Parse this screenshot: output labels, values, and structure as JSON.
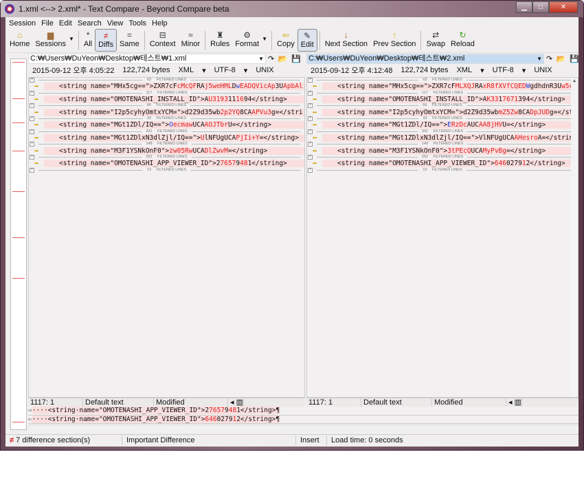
{
  "window": {
    "title": "1.xml <--> 2.xml* - Text Compare - Beyond Compare beta"
  },
  "menu": [
    "Session",
    "File",
    "Edit",
    "Search",
    "View",
    "Tools",
    "Help"
  ],
  "toolbar": [
    {
      "label": "Home",
      "icon": "home-icon",
      "glyph": "⌂"
    },
    {
      "label": "Sessions",
      "icon": "briefcase-icon",
      "glyph": "▆",
      "dropdown": true
    },
    {
      "sep": true
    },
    {
      "label": "All",
      "icon": "asterisk-icon",
      "glyph": "*"
    },
    {
      "label": "Diffs",
      "icon": "not-equal-icon",
      "glyph": "≠",
      "active": true
    },
    {
      "label": "Same",
      "icon": "equal-icon",
      "glyph": "="
    },
    {
      "sep": true
    },
    {
      "label": "Context",
      "icon": "context-icon",
      "glyph": "⊟"
    },
    {
      "label": "Minor",
      "icon": "approx-icon",
      "glyph": "≈"
    },
    {
      "sep": true
    },
    {
      "label": "Rules",
      "icon": "rules-icon",
      "glyph": "♜"
    },
    {
      "label": "Format",
      "icon": "format-icon",
      "glyph": "⚙",
      "dropdown": true
    },
    {
      "sep": true
    },
    {
      "label": "Copy",
      "icon": "copy-left-arrow-icon",
      "glyph": "⇦"
    },
    {
      "label": "Edit",
      "icon": "edit-icon",
      "glyph": "✎",
      "active": true
    },
    {
      "sep": true
    },
    {
      "label": "Next Section",
      "icon": "down-arrow-icon",
      "glyph": "↓"
    },
    {
      "label": "Prev Section",
      "icon": "up-arrow-icon",
      "glyph": "↑"
    },
    {
      "sep": true
    },
    {
      "label": "Swap",
      "icon": "swap-icon",
      "glyph": "⇄"
    },
    {
      "label": "Reload",
      "icon": "reload-icon",
      "glyph": "↻"
    }
  ],
  "colors": {
    "diff_bg": "#fadede",
    "diff_text": "#e02020",
    "minor_text": "#2040e0",
    "selected_path": "#c6dcf2"
  },
  "filtered_label": "FILTERED LINES",
  "filtered_counts": [
    "63",
    "117",
    "66",
    "33",
    "331",
    "148",
    "292",
    "13"
  ],
  "left": {
    "path": "C:₩Users₩DuYeon₩Desktop₩테스트₩1.xml",
    "info": {
      "date": "2015-09-12 오후 4:05:22",
      "size": "122,724 bytes",
      "format": "XML",
      "encoding": "UTF-8",
      "eol": "UNIX"
    },
    "lines": [
      [
        [
          "<string name=\"MHx5cg==\">ZXR7cF",
          0
        ],
        [
          "cMcQF",
          1
        ],
        [
          "RA",
          0
        ],
        [
          "j5weHML",
          1
        ],
        [
          "D",
          0
        ],
        [
          "w",
          2
        ],
        [
          "EADQVicAp",
          1
        ],
        [
          "3U",
          0
        ],
        [
          "ApbAl",
          1
        ]
      ],
      [
        [
          "<string name=\"OMOTENASHI_INSTALL_ID\">A",
          0
        ],
        [
          "U3193",
          1
        ],
        [
          "11",
          0
        ],
        [
          "16",
          1
        ],
        [
          "94</string>",
          0
        ]
      ],
      [
        [
          "<string name=\"I2p5cyhyOmtxYCM=\">d2Z9d35wb",
          0
        ],
        [
          "2p2YQ",
          1
        ],
        [
          "8CA",
          0
        ],
        [
          "APVu3",
          1
        ],
        [
          "g=</stri",
          0
        ]
      ],
      [
        [
          "<string name=\"MGt1ZDl/IQ==\">",
          0
        ],
        [
          "O",
          2
        ],
        [
          "ecmaw",
          1
        ],
        [
          "UCA",
          0
        ],
        [
          "AOJTbr",
          1
        ],
        [
          "U=</string>",
          0
        ]
      ],
      [
        [
          "<string name=\"MGt1ZDlxN3dlZjl/IQ==\">",
          0
        ],
        [
          "U",
          1
        ],
        [
          "lNFUgUCA",
          0
        ],
        [
          "PjIi+Y",
          1
        ],
        [
          "=</string>",
          0
        ]
      ],
      [
        [
          "<string name=\"M3F1YSNkOnF0\">",
          0
        ],
        [
          "zw05Rw",
          1
        ],
        [
          "UCA",
          0
        ],
        [
          "DlZwvM",
          1
        ],
        [
          "=</string>",
          0
        ]
      ],
      [
        [
          "<string name=\"OMOTENASHI_APP_VIEWER_ID\">2",
          0
        ],
        [
          "7657",
          1
        ],
        [
          "9",
          0
        ],
        [
          "48",
          1
        ],
        [
          "1</string>",
          0
        ]
      ]
    ],
    "status": {
      "position": "1117: 1",
      "style": "Default text",
      "state": "Modified"
    }
  },
  "right": {
    "path": "C:₩Users₩DuYeon₩Desktop₩테스트₩2.xml",
    "info": {
      "date": "2015-09-12 오후 4:12:48",
      "size": "122,724 bytes",
      "format": "XML",
      "encoding": "UTF-8",
      "eol": "UNIX"
    },
    "lines": [
      [
        [
          "<string name=\"MHx5cg==\">ZXR7cF",
          0
        ],
        [
          "MLXQJ",
          1
        ],
        [
          "RA",
          0
        ],
        [
          "xR8fXVfCQED",
          1
        ],
        [
          "W",
          2
        ],
        [
          "gdhdnR3U",
          0
        ],
        [
          "w5cAH",
          1
        ]
      ],
      [
        [
          "<string name=\"OMOTENASHI_INSTALL_ID\">A",
          0
        ],
        [
          "K33",
          1
        ],
        [
          "1",
          0
        ],
        [
          "7671",
          1
        ],
        [
          "394</string>",
          0
        ]
      ],
      [
        [
          "<string name=\"I2p5cyhyOmtxYCM=\">d2Z9d35wb",
          0
        ],
        [
          "mZ5Zw",
          1
        ],
        [
          "8CA",
          0
        ],
        [
          "DpJUD",
          1
        ],
        [
          "g=</stri",
          0
        ]
      ],
      [
        [
          "<string name=\"MGt1ZDl/IQ==\">",
          0
        ],
        [
          "E",
          2
        ],
        [
          "RzDc",
          1
        ],
        [
          "AUC",
          0
        ],
        [
          "AA8jHV",
          1
        ],
        [
          "U=</string>",
          0
        ]
      ],
      [
        [
          "<string name=\"MGt1ZDlxN3dlZjl/IQ==\">VlNFUgUCA",
          0
        ],
        [
          "AHesro",
          1
        ],
        [
          "A=</string>",
          0
        ]
      ],
      [
        [
          "<string name=\"M3F1YSNkOnF0\">",
          0
        ],
        [
          "3tPEcQ",
          1
        ],
        [
          "UCA",
          0
        ],
        [
          "MyPvBg",
          1
        ],
        [
          "=</string>",
          0
        ]
      ],
      [
        [
          "<string name=\"OMOTENASHI_APP_VIEWER_ID\">",
          0
        ],
        [
          "646",
          1
        ],
        [
          "0279",
          0
        ],
        [
          "1",
          1
        ],
        [
          "2</string>",
          0
        ]
      ]
    ],
    "status": {
      "position": "1117: 1",
      "style": "Default text",
      "state": "Modified"
    }
  },
  "bottom_compare": [
    [
      [
        "····<string·name=\"OMOTENASHI_APP_VIEWER_ID\">2",
        0
      ],
      [
        "7657",
        1
      ],
      [
        "9",
        0
      ],
      [
        "48",
        1
      ],
      [
        "1</string>¶",
        0
      ]
    ],
    [
      [
        "····<string·name=\"OMOTENASHI_APP_VIEWER_ID\">",
        0
      ],
      [
        "646",
        1
      ],
      [
        "0279",
        0
      ],
      [
        "1",
        1
      ],
      [
        "2</string>¶",
        0
      ]
    ]
  ],
  "statusbar": {
    "diff_count": "7 difference section(s)",
    "importance": "Important Difference",
    "mode": "Insert",
    "load_time": "Load time: 0 seconds"
  }
}
